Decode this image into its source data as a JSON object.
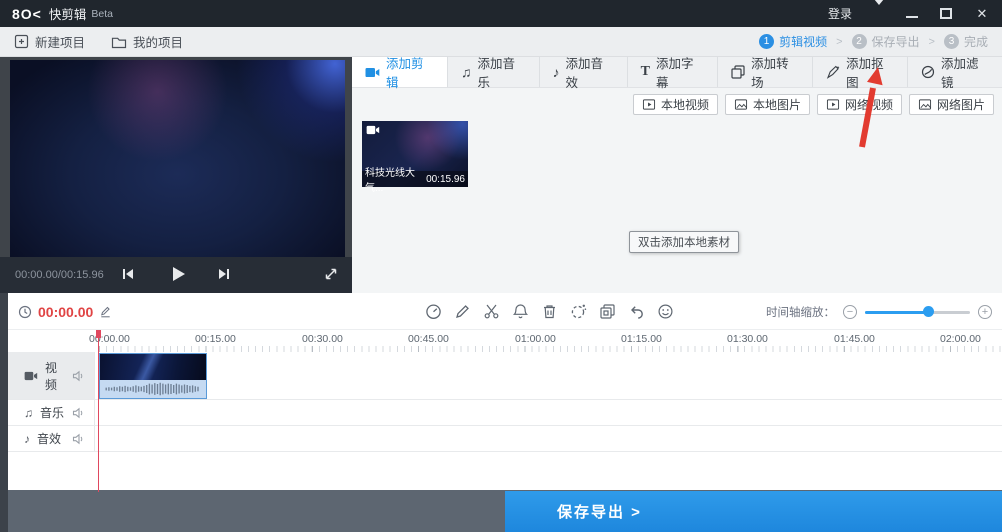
{
  "titlebar": {
    "logo": "8O<",
    "app": "快剪辑",
    "beta": "Beta",
    "login": "登录"
  },
  "projectbar": {
    "new_project": "新建项目",
    "my_projects": "我的项目",
    "sep": ">",
    "steps": [
      {
        "num": "1",
        "label": "剪辑视频"
      },
      {
        "num": "2",
        "label": "保存导出"
      },
      {
        "num": "3",
        "label": "完成"
      }
    ]
  },
  "tabs": [
    {
      "label": "添加剪辑"
    },
    {
      "label": "添加音乐"
    },
    {
      "label": "添加音效"
    },
    {
      "label": "添加字幕"
    },
    {
      "label": "添加转场"
    },
    {
      "label": "添加抠图"
    },
    {
      "label": "添加滤镜"
    }
  ],
  "sources": [
    {
      "label": "本地视频"
    },
    {
      "label": "本地图片"
    },
    {
      "label": "网络视频"
    },
    {
      "label": "网络图片"
    }
  ],
  "library": {
    "clip_title": "科技光线大气...",
    "clip_duration": "00:15.96",
    "tooltip": "双击添加本地素材"
  },
  "preview": {
    "time": "00:00.00/00:15.96"
  },
  "timeline": {
    "current_time": "00:00.00",
    "zoom_label": "时间轴缩放：",
    "zoom_minus": "−",
    "zoom_plus": "+",
    "ruler": [
      "00:00.00",
      "00:15.00",
      "00:30.00",
      "00:45.00",
      "01:00.00",
      "01:15.00",
      "01:30.00",
      "01:45.00",
      "02:00.00"
    ],
    "tracks": [
      {
        "label": "视频"
      },
      {
        "label": "音乐"
      },
      {
        "label": "音效"
      }
    ]
  },
  "icons": {
    "music_note": "♫",
    "sfx_note": "♪",
    "text_tool": "T"
  },
  "export_label": "保存导出 >",
  "colors": {
    "accent": "#2190e3",
    "playhead": "#e0485f",
    "time_red": "#e04444",
    "arrow_red": "#e23b30"
  }
}
